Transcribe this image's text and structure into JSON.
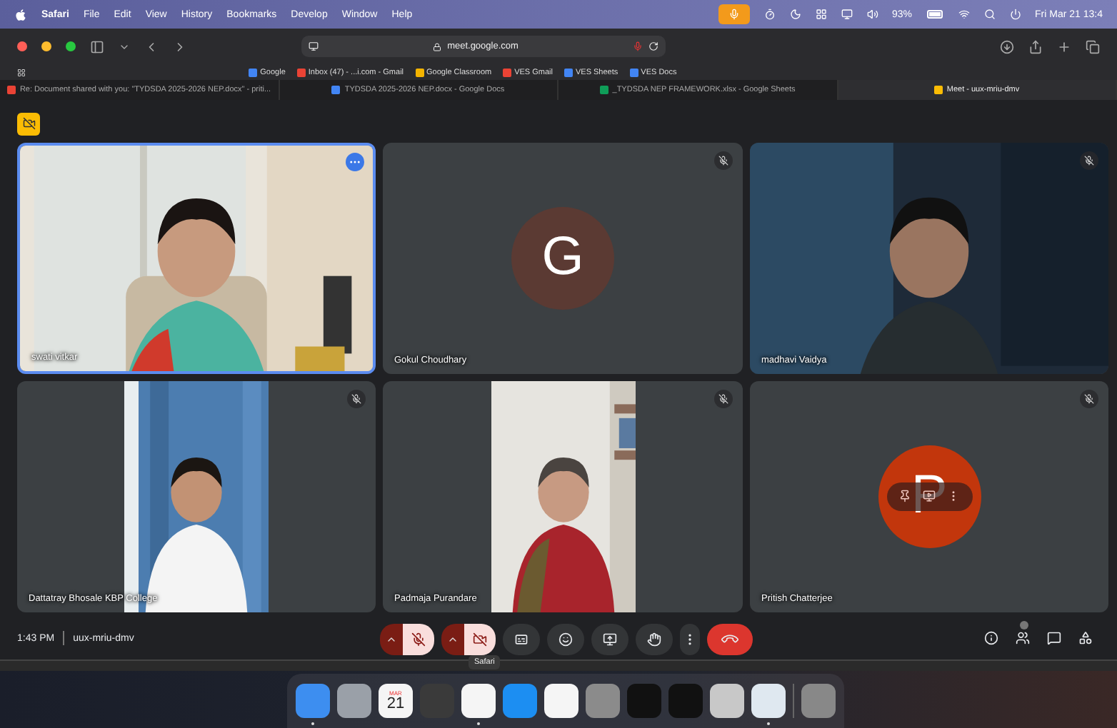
{
  "menubar": {
    "app": "Safari",
    "menus": [
      "File",
      "Edit",
      "View",
      "History",
      "Bookmarks",
      "Develop",
      "Window",
      "Help"
    ],
    "mic_in_use": true,
    "battery": "93%",
    "clock": "Fri Mar 21 13:4"
  },
  "browser": {
    "address": "meet.google.com",
    "bookmarks": [
      {
        "label": "Google",
        "color": "#4285f4"
      },
      {
        "label": "Inbox (47) - ...i.com - Gmail",
        "color": "#ea4335"
      },
      {
        "label": "Google Classroom",
        "color": "#f4b400"
      },
      {
        "label": "VES Gmail",
        "color": "#ea4335"
      },
      {
        "label": "VES Sheets",
        "color": "#4285f4"
      },
      {
        "label": "VES Docs",
        "color": "#4285f4"
      }
    ],
    "tabs": [
      {
        "label": "Re: Document shared with you: \"TYDSDA 2025-2026 NEP.docx\" - priti...",
        "color": "#ea4335",
        "selected": false
      },
      {
        "label": "TYDSDA 2025-2026 NEP.docx - Google Docs",
        "color": "#4285f4",
        "selected": false
      },
      {
        "label": "_TYDSDA NEP FRAMEWORK.xlsx - Google Sheets",
        "color": "#0f9d58",
        "selected": false
      },
      {
        "label": "Meet - uux-mriu-dmv",
        "color": "#fbbc04",
        "selected": true
      }
    ]
  },
  "meet": {
    "tiles": [
      {
        "kind": "video",
        "portrait": false,
        "name": "swati vitkar",
        "speaking": true,
        "muted": false,
        "hovered": false
      },
      {
        "kind": "avatar",
        "initial": "G",
        "color": "#5b3a33",
        "name": "Gokul Choudhary",
        "speaking": false,
        "muted": true,
        "hovered": false
      },
      {
        "kind": "video",
        "portrait": false,
        "name": "madhavi Vaidya",
        "speaking": false,
        "muted": true,
        "hovered": false
      },
      {
        "kind": "video",
        "portrait": true,
        "name": "Dattatray Bhosale KBP College",
        "speaking": false,
        "muted": true,
        "hovered": false
      },
      {
        "kind": "video",
        "portrait": true,
        "name": "Padmaja Purandare",
        "speaking": false,
        "muted": true,
        "hovered": false
      },
      {
        "kind": "avatar",
        "initial": "P",
        "color": "#c2360c",
        "name": "Pritish Chatterjee",
        "speaking": false,
        "muted": true,
        "hovered": true
      }
    ],
    "time": "1:43 PM",
    "code": "uux-mriu-dmv",
    "controls": [
      {
        "kind": "split",
        "on": false
      },
      {
        "kind": "split",
        "on": false
      },
      {
        "kind": "round"
      },
      {
        "kind": "round"
      },
      {
        "kind": "round"
      },
      {
        "kind": "round"
      },
      {
        "kind": "narrow"
      },
      {
        "kind": "end"
      }
    ],
    "tooltip": "Safari"
  },
  "dock": {
    "calendar_month": "MAR",
    "calendar_day": "21",
    "items": [
      {
        "running": true
      },
      {
        "running": false
      },
      {
        "running": false
      },
      {
        "running": false
      },
      {
        "running": true
      },
      {
        "running": false
      },
      {
        "running": false
      },
      {
        "running": false
      },
      {
        "running": false
      },
      {
        "running": false
      },
      {
        "running": false
      },
      {
        "running": true
      },
      {
        "running": false
      }
    ]
  }
}
